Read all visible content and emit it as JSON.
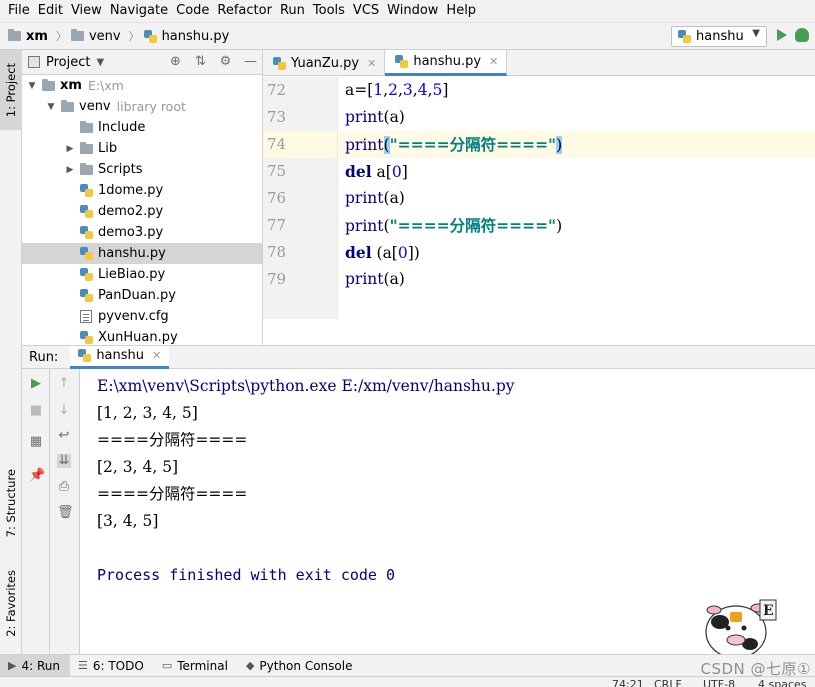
{
  "menu": [
    "File",
    "Edit",
    "View",
    "Navigate",
    "Code",
    "Refactor",
    "Run",
    "Tools",
    "VCS",
    "Window",
    "Help"
  ],
  "menu_mnemonics": [
    "F",
    "E",
    "V",
    "N",
    "C",
    "R",
    "u",
    "T",
    "S",
    "W",
    "H"
  ],
  "breadcrumb": {
    "root": "xm",
    "folder": "venv",
    "file": "hanshu.py"
  },
  "run_config": {
    "name": "hanshu"
  },
  "side_tabs": {
    "project": "1: Project",
    "structure": "7: Structure",
    "favorites": "2: Favorites"
  },
  "project_panel": {
    "title": "Project",
    "tree": [
      {
        "label": "xm",
        "note": "E:\\xm",
        "kind": "folder",
        "level": 0,
        "expanded": true,
        "bold": true
      },
      {
        "label": "venv",
        "note": "library root",
        "kind": "folder",
        "level": 1,
        "expanded": true
      },
      {
        "label": "Include",
        "note": "",
        "kind": "folder",
        "level": 2
      },
      {
        "label": "Lib",
        "note": "",
        "kind": "folder",
        "level": 2,
        "collapsed": true
      },
      {
        "label": "Scripts",
        "note": "",
        "kind": "folder",
        "level": 2,
        "collapsed": true
      },
      {
        "label": "1dome.py",
        "note": "",
        "kind": "py",
        "level": 2
      },
      {
        "label": "demo2.py",
        "note": "",
        "kind": "py",
        "level": 2
      },
      {
        "label": "demo3.py",
        "note": "",
        "kind": "py",
        "level": 2
      },
      {
        "label": "hanshu.py",
        "note": "",
        "kind": "py",
        "level": 2,
        "selected": true
      },
      {
        "label": "LieBiao.py",
        "note": "",
        "kind": "py",
        "level": 2
      },
      {
        "label": "PanDuan.py",
        "note": "",
        "kind": "py",
        "level": 2
      },
      {
        "label": "pyvenv.cfg",
        "note": "",
        "kind": "cfg",
        "level": 2
      },
      {
        "label": "XunHuan.py",
        "note": "",
        "kind": "py",
        "level": 2
      }
    ]
  },
  "editor": {
    "tabs": [
      {
        "label": "YuanZu.py",
        "active": false
      },
      {
        "label": "hanshu.py",
        "active": true
      }
    ],
    "lines": [
      {
        "num": "72",
        "tokens": [
          [
            "plain",
            "a=["
          ],
          [
            "num",
            "1"
          ],
          [
            "plain",
            ","
          ],
          [
            "num",
            "2"
          ],
          [
            "plain",
            ","
          ],
          [
            "num",
            "3"
          ],
          [
            "plain",
            ","
          ],
          [
            "num",
            "4"
          ],
          [
            "plain",
            ","
          ],
          [
            "num",
            "5"
          ],
          [
            "plain",
            "]"
          ]
        ]
      },
      {
        "num": "73",
        "tokens": [
          [
            "fn",
            "print"
          ],
          [
            "plain",
            "(a)"
          ]
        ]
      },
      {
        "num": "74",
        "current": true,
        "tokens": [
          [
            "fn",
            "print"
          ],
          [
            "hl",
            "("
          ],
          [
            "str",
            "\"====分隔符====\""
          ],
          [
            "hl",
            ")"
          ]
        ]
      },
      {
        "num": "75",
        "tokens": [
          [
            "del",
            "del"
          ],
          [
            "plain",
            " a["
          ],
          [
            "num",
            "0"
          ],
          [
            "plain",
            "]"
          ]
        ]
      },
      {
        "num": "76",
        "tokens": [
          [
            "fn",
            "print"
          ],
          [
            "plain",
            "(a)"
          ]
        ]
      },
      {
        "num": "77",
        "tokens": [
          [
            "fn",
            "print"
          ],
          [
            "plain",
            "("
          ],
          [
            "str",
            "\"====分隔符====\""
          ],
          [
            "plain",
            ")"
          ]
        ]
      },
      {
        "num": "78",
        "tokens": [
          [
            "del",
            "del"
          ],
          [
            "plain",
            " (a["
          ],
          [
            "num",
            "0"
          ],
          [
            "plain",
            "])"
          ]
        ]
      },
      {
        "num": "79",
        "tokens": [
          [
            "fn",
            "print"
          ],
          [
            "plain",
            "(a)"
          ]
        ]
      }
    ]
  },
  "run_panel": {
    "label": "Run:",
    "tab": "hanshu",
    "output": [
      {
        "text": "E:\\xm\\venv\\Scripts\\python.exe E:/xm/venv/hanshu.py",
        "kind": "path"
      },
      {
        "text": "[1, 2, 3, 4, 5]",
        "kind": "out"
      },
      {
        "text": "====分隔符====",
        "kind": "out"
      },
      {
        "text": "[2, 3, 4, 5]",
        "kind": "out"
      },
      {
        "text": "====分隔符====",
        "kind": "out"
      },
      {
        "text": "[3, 4, 5]",
        "kind": "out"
      },
      {
        "text": "",
        "kind": "out"
      },
      {
        "text": "Process finished with exit code 0",
        "kind": "proc"
      }
    ]
  },
  "bottom_tabs": [
    {
      "label": "4: Run",
      "icon": "run-icon",
      "active": true
    },
    {
      "label": "6: TODO",
      "icon": "todo-icon",
      "active": false
    },
    {
      "label": "Terminal",
      "icon": "terminal-icon",
      "active": false
    },
    {
      "label": "Python Console",
      "icon": "python-console-icon",
      "active": false
    }
  ],
  "status": {
    "position": "74:21",
    "line_sep": "CRLF",
    "encoding": "UTF-8",
    "indent": "4 spaces"
  },
  "watermark": "CSDN @七原①",
  "colors": {
    "keyword": "#000080",
    "number": "#0000ff",
    "string": "#008080",
    "selection": "#d5d5d5",
    "accent": "#4083c9",
    "run_green": "#499c54"
  }
}
